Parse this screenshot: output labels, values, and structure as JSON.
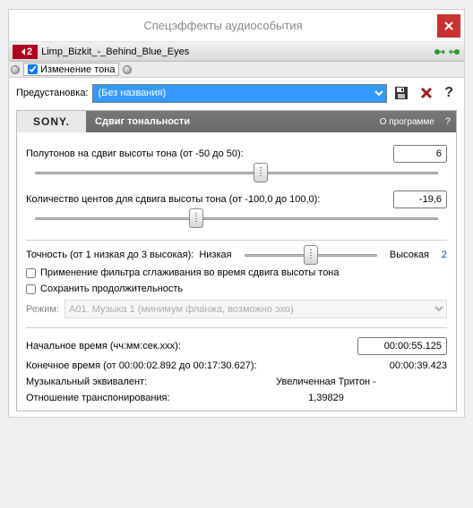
{
  "window": {
    "title": "Спецэффекты аудиособытия"
  },
  "file": {
    "badge": "2",
    "name": "Limp_Bizkit_-_Behind_Blue_Eyes"
  },
  "tone_change": {
    "label": "Изменение тона"
  },
  "preset": {
    "label": "Предустановка:",
    "value": "(Без названия)"
  },
  "plugin": {
    "brand": "SONY.",
    "title": "Сдвиг тональности",
    "about": "О программе",
    "semitones_label": "Полутонов на сдвиг высоты тона (от -50 до 50):",
    "semitones_value": "6",
    "cents_label": "Количество центов для сдвига высоты тона (от -100,0 до 100,0):",
    "cents_value": "-19,6",
    "accuracy_label": "Точность (от 1 низкая до 3 высокая):",
    "accuracy_low": "Низкая",
    "accuracy_high": "Высокая",
    "accuracy_value": "2",
    "antialias_label": "Применение фильтра сглаживания во время сдвига высоты тона",
    "preserve_label": "Сохранить продолжительность",
    "mode_label": "Режим:",
    "mode_value": "A01. Музыка 1 (минимум фланжа, возможно эхо)",
    "start_time_label": "Начальное время (чч:мм:сек.xxx):",
    "start_time_value": "00:00:55.125",
    "end_time_label": "Конечное время (от 00:00:02.892 до 00:17:30.627):",
    "end_time_value": "00:00:39.423",
    "musical_eq_label": "Музыкальный эквивалент:",
    "musical_eq_value": "Увеличенная Тритон -",
    "transpose_ratio_label": "Отношение транспонирования:",
    "transpose_ratio_value": "1,39829"
  }
}
